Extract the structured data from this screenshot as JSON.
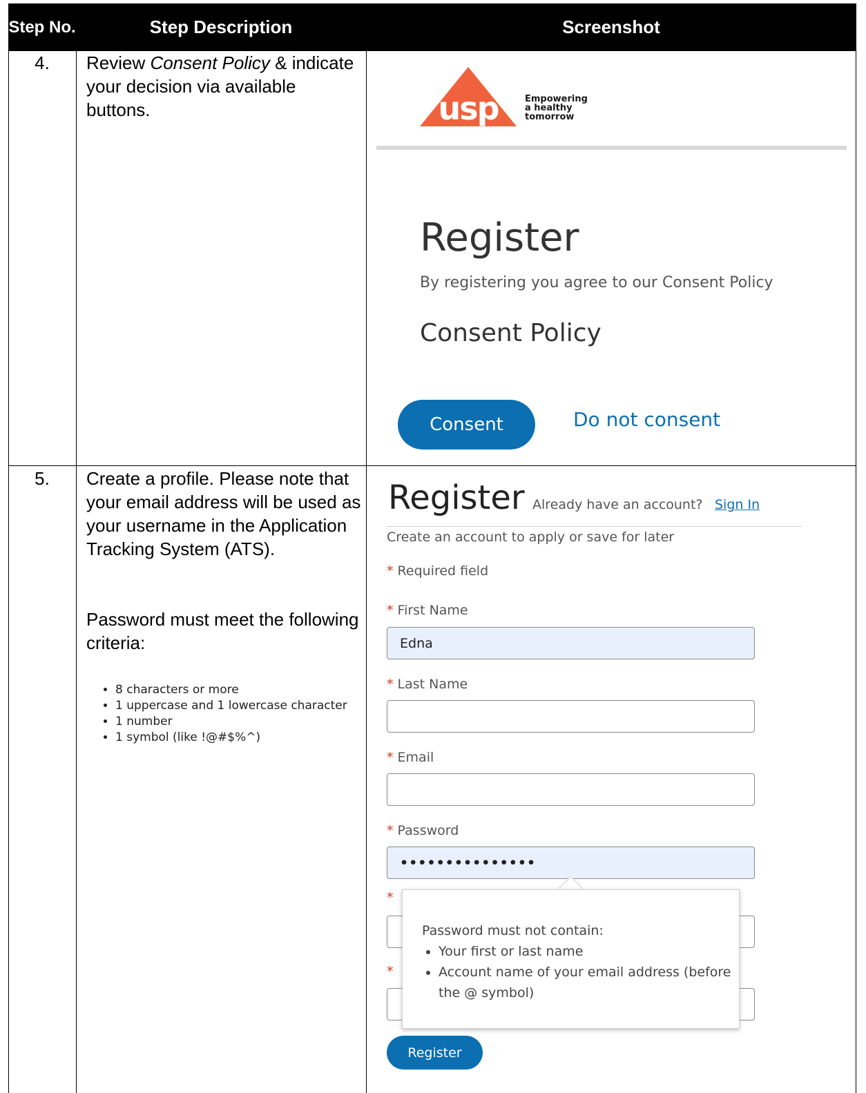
{
  "header": {
    "step_no": "Step No.",
    "step_description": "Step Description",
    "screenshot": "Screenshot"
  },
  "rows": [
    {
      "step_no": "4.",
      "description_parts": [
        "Review ",
        "Consent Policy",
        " & indicate your decision via available buttons."
      ],
      "screenshot": {
        "logo_text": "usp",
        "logo_tagline": [
          "Empowering",
          "a healthy",
          "tomorrow"
        ],
        "title": "Register",
        "subtitle": "By registering you agree to our Consent Policy",
        "section_heading": "Consent Policy",
        "consent_button": "Consent",
        "decline_link": "Do not consent",
        "brand_color": "#f0623d",
        "accent_color": "#0b6fb2"
      }
    },
    {
      "step_no": "5.",
      "description": "Create a profile. Please note that your email address will be used as your username in the Application Tracking System (ATS).",
      "password_intro": "Password must meet the following criteria:",
      "criteria": [
        "8 characters or more",
        "1 uppercase and 1 lowercase character",
        "1 number",
        "1 symbol (like !@#$%^)"
      ],
      "screenshot": {
        "title": "Register",
        "already_text": "Already have an account?",
        "sign_in": "Sign In",
        "create_text": "Create an account to apply or save for later",
        "required_star": "*",
        "required_note": "Required field",
        "first_name_label": "First Name",
        "first_name_value": "Edna",
        "last_name_label": "Last Name",
        "email_label": "Email",
        "password_label": "Password",
        "password_value": "•••••••••••••••",
        "tooltip_title": "Password must not contain:",
        "tooltip_items": [
          "Your first or last name",
          "Account name of your email address (before the @ symbol)"
        ],
        "register_button": "Register"
      }
    }
  ]
}
